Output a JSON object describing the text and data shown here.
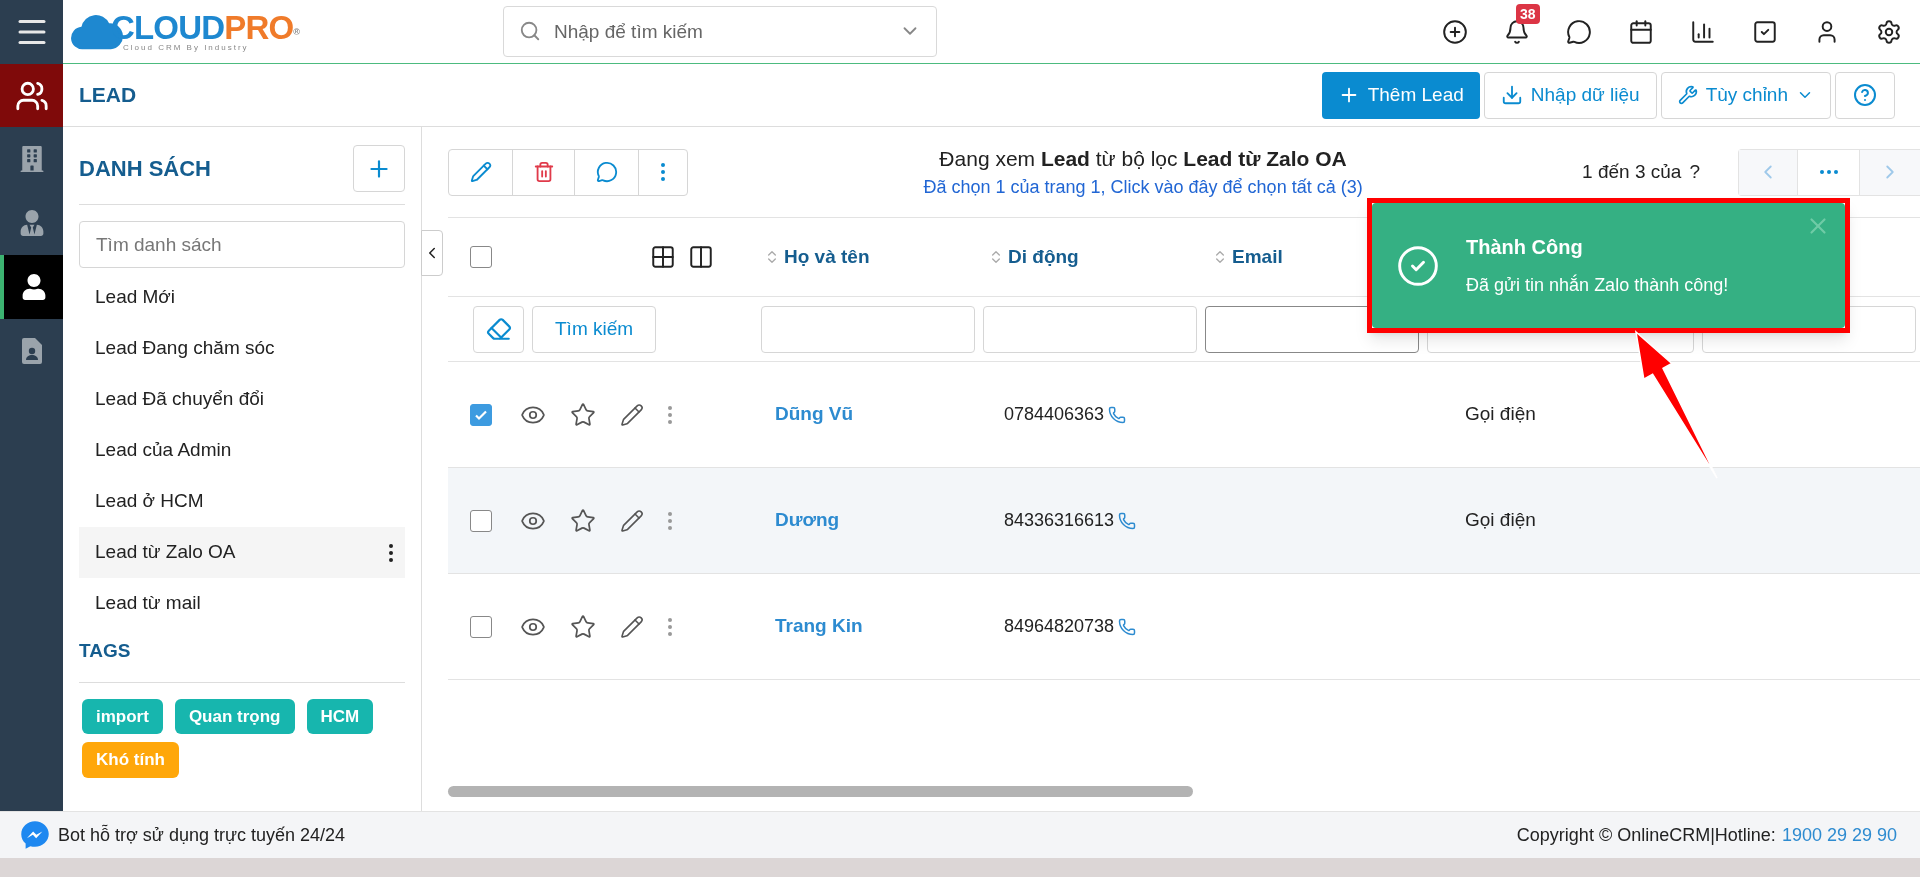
{
  "topbar": {
    "logo_main": "CLOUD",
    "logo_accent": "PRO",
    "logo_mark": "®",
    "logo_tagline": "Cloud CRM By Industry",
    "search_placeholder": "Nhập để tìm kiếm",
    "notification_count": "38"
  },
  "rail": {
    "items": [
      {
        "selected": false
      },
      {
        "selected": false
      },
      {
        "selected": true
      },
      {
        "selected": false
      }
    ]
  },
  "page_title": "LEAD",
  "header_buttons": [
    {
      "kind": "primary",
      "label": "Thêm Lead"
    },
    {
      "kind": "import",
      "label": "Nhập dữ liệu"
    },
    {
      "kind": "dropdown",
      "label": "Tùy chỉnh"
    },
    {
      "kind": "help"
    }
  ],
  "sidebar": {
    "title": "DANH SÁCH",
    "search_placeholder": "Tìm danh sách",
    "items": [
      {
        "label": "Lead Mới",
        "selected": false
      },
      {
        "label": "Lead Đang chăm sóc",
        "selected": false
      },
      {
        "label": "Lead Đã chuyển đổi",
        "selected": false
      },
      {
        "label": "Lead của Admin",
        "selected": false
      },
      {
        "label": "Lead ở HCM",
        "selected": false
      },
      {
        "label": "Lead từ Zalo OA",
        "selected": true
      },
      {
        "label": "Lead từ mail",
        "selected": false
      }
    ],
    "tags_title": "TAGS",
    "tags": [
      {
        "label": "import",
        "color": "#17b6ae"
      },
      {
        "label": "Quan trọng",
        "color": "#17b6ae"
      },
      {
        "label": "HCM",
        "color": "#17b6ae"
      },
      {
        "label": "Khó tính",
        "color": "#ffa70a"
      }
    ]
  },
  "summary": "Đang xem **Lead** từ bộ lọc **Lead từ Zalo OA**",
  "selection_link": "Đã chọn 1 của trang 1, Click vào đây để chọn tất cả (3)",
  "pagination": {
    "range": "1 đến 3 của",
    "total": "?"
  },
  "table": {
    "select_all": {
      "checked": false
    },
    "columns": [
      "Họ và tên",
      "Di động",
      "Email"
    ],
    "filter_button": "Tìm kiếm",
    "rows": [
      {
        "checked": true,
        "hovered": false,
        "name": "Dũng Vũ",
        "phone": "0784406363",
        "column_4": "Gọi điện"
      },
      {
        "checked": false,
        "hovered": true,
        "name": "Dương",
        "phone": "84336316613",
        "column_4": "Gọi điện"
      },
      {
        "checked": false,
        "hovered": false,
        "name": "Trang Kin",
        "phone": "84964820738"
      }
    ]
  },
  "toast": {
    "title": "Thành Công",
    "message": "Đã gửi tin nhắn Zalo thành công!"
  },
  "footer": {
    "support": "Bot hỗ trợ sử dụng trực tuyến 24/24",
    "copyright": "Copyright © OnlineCRM|Hotline:",
    "hotline": "1900 29 29 90"
  }
}
